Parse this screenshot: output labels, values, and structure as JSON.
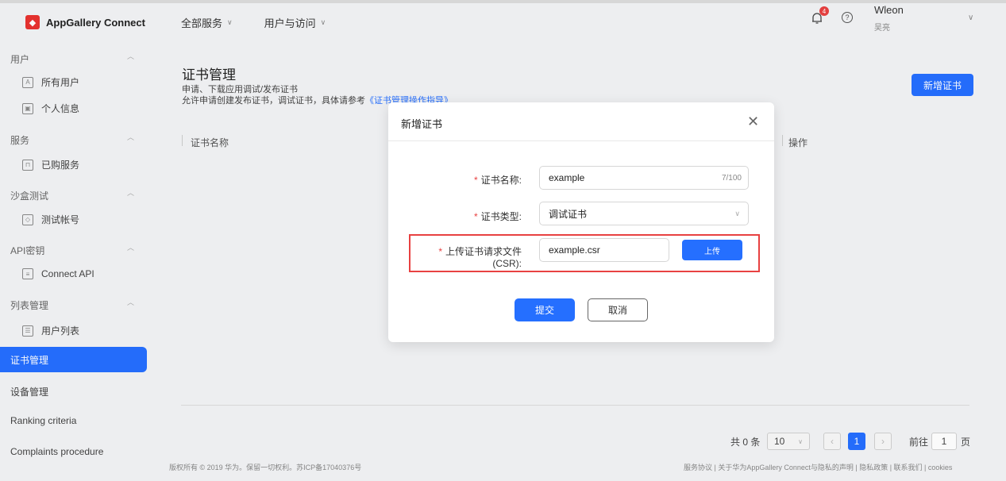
{
  "header": {
    "brand": "AppGallery Connect",
    "nav": [
      "全部服务",
      "用户与访问"
    ],
    "notification_count": "4",
    "user_name": "Wleon",
    "user_sub": "吴亮"
  },
  "sidebar": {
    "groups": [
      {
        "label": "用户",
        "items": [
          "所有用户",
          "个人信息"
        ]
      },
      {
        "label": "服务",
        "items": [
          "已购服务"
        ]
      },
      {
        "label": "沙盒测试",
        "items": [
          "测试帐号"
        ]
      },
      {
        "label": "API密钥",
        "items": [
          "Connect API"
        ]
      },
      {
        "label": "列表管理",
        "items": [
          "用户列表"
        ]
      }
    ],
    "active": "证书管理",
    "bottom": [
      "设备管理",
      "Ranking criteria",
      "Complaints procedure"
    ]
  },
  "page": {
    "title": "证书管理",
    "desc1": "申请、下载应用调试/发布证书",
    "desc2": "允许申请创建发布证书，调试证书，具体请参考",
    "desc_link": "《证书管理操作指导》",
    "new_button": "新增证书",
    "columns": [
      "证书名称",
      "操作"
    ]
  },
  "pager": {
    "total": "共 0 条",
    "page_size": "10",
    "current": "1",
    "goto_label": "前往",
    "goto_value": "1",
    "page_suffix": "页"
  },
  "footer": {
    "left": "版权所有 © 2019 华为。保留一切权利。苏ICP备17040376号",
    "right": "服务协议 | 关于华为AppGallery Connect与隐私的声明 | 隐私政策 | 联系我们 | cookies"
  },
  "modal": {
    "title": "新增证书",
    "fields": {
      "name_label": "证书名称:",
      "name_value": "example",
      "name_count": "7/100",
      "type_label": "证书类型:",
      "type_value": "调试证书",
      "csr_label": "上传证书请求文件(CSR):",
      "csr_value": "example.csr"
    },
    "upload_button": "上传",
    "submit_button": "提交",
    "cancel_button": "取消"
  },
  "colors": {
    "accent": "#256fff",
    "highlight_border": "#e84141"
  }
}
